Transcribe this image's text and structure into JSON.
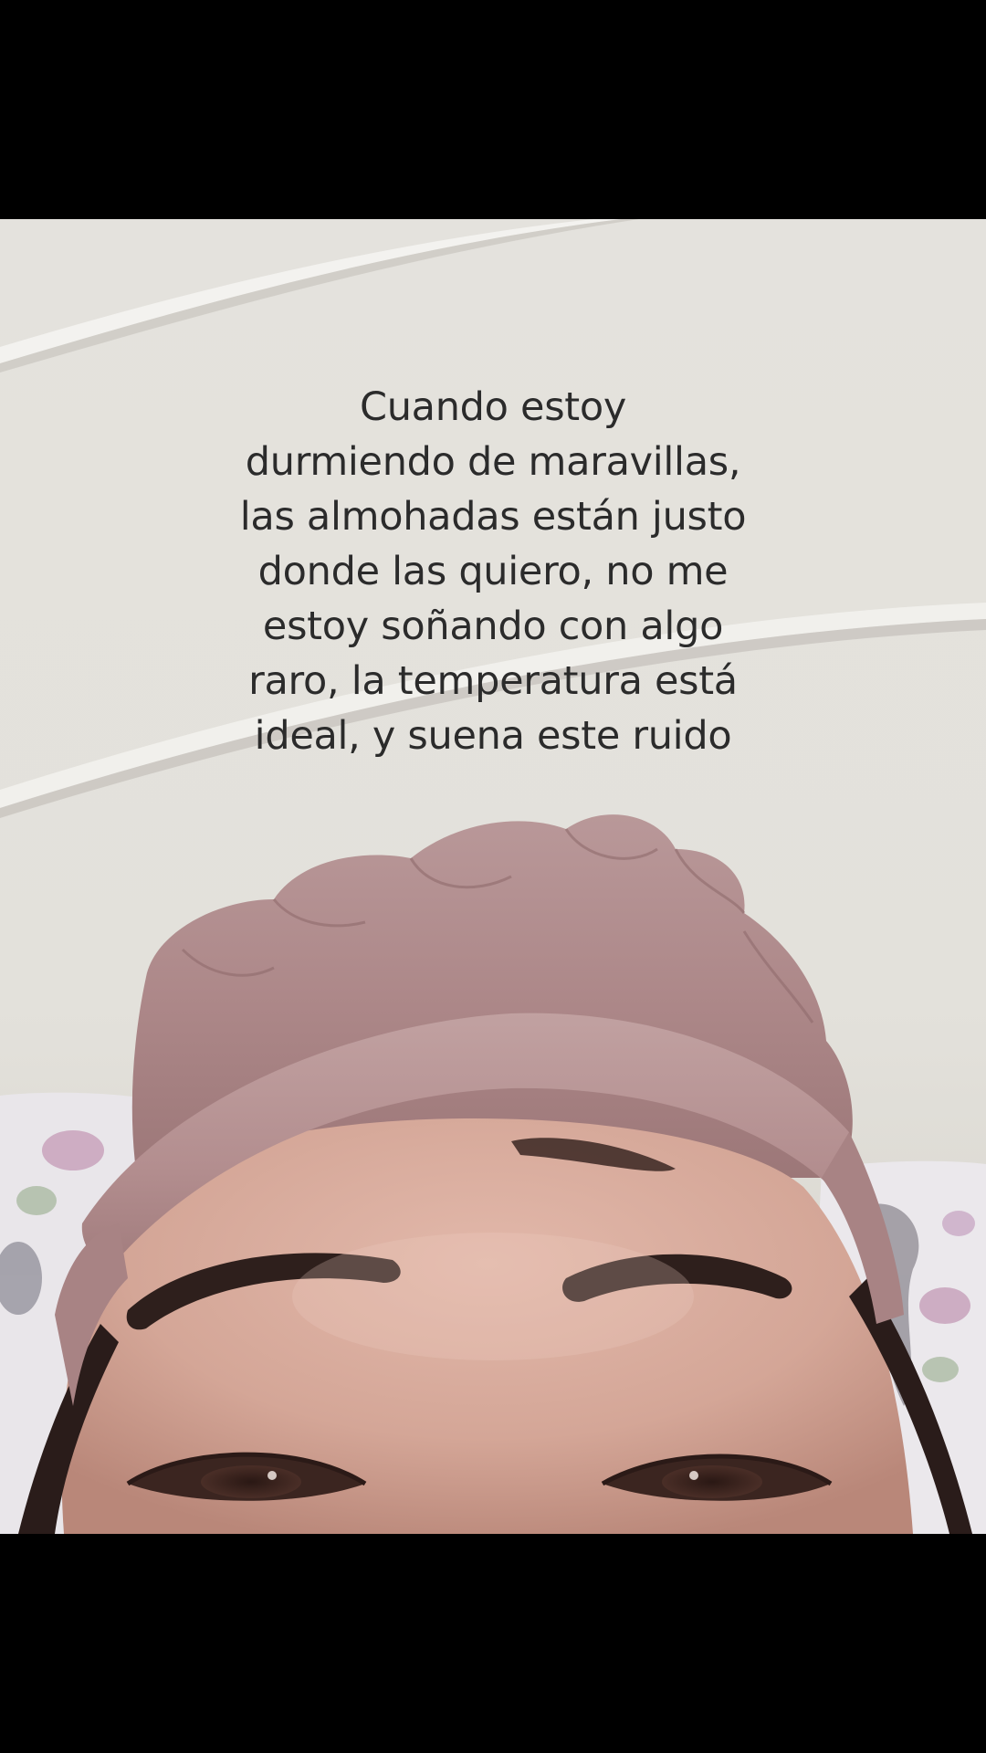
{
  "overlay": {
    "caption": "Cuando estoy\ndurmiendo de maravillas,\nlas almohadas están justo\ndonde las quiero, no me\nestoy soñando con algo\nraro, la temperatura está\nideal, y suena este ruido"
  },
  "colors": {
    "letterbox": "#000000",
    "wall": "#e3e1dc",
    "molding": "#f2f1ee",
    "bonnet": "#b0898a",
    "skin": "#d7ada0",
    "text": "#2b2b2b"
  }
}
